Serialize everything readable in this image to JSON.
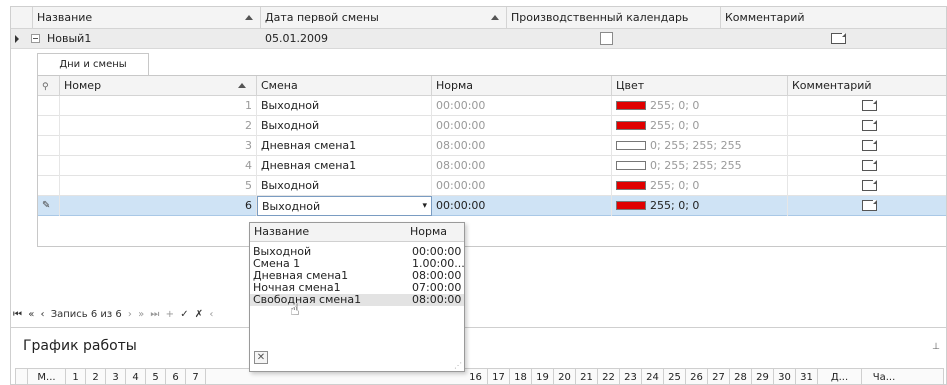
{
  "master": {
    "headers": [
      "Название",
      "Дата первой смены",
      "Производственный календарь",
      "Комментарий"
    ],
    "row": {
      "name": "Новый1",
      "date": "05.01.2009"
    }
  },
  "detail": {
    "tab": "Дни и смены",
    "headers": [
      "Номер",
      "Смена",
      "Норма",
      "Цвет",
      "Комментарий"
    ],
    "rows": [
      {
        "num": "1",
        "shift": "Выходной",
        "norm": "00:00:00",
        "color": "255; 0; 0",
        "swatch": "#e00000"
      },
      {
        "num": "2",
        "shift": "Выходной",
        "norm": "00:00:00",
        "color": "255; 0; 0",
        "swatch": "#e00000"
      },
      {
        "num": "3",
        "shift": "Дневная смена1",
        "norm": "08:00:00",
        "color": "0; 255; 255; 255",
        "swatch": "#ffffff"
      },
      {
        "num": "4",
        "shift": "Дневная смена1",
        "norm": "08:00:00",
        "color": "0; 255; 255; 255",
        "swatch": "#ffffff"
      },
      {
        "num": "5",
        "shift": "Выходной",
        "norm": "00:00:00",
        "color": "255; 0; 0",
        "swatch": "#e00000"
      },
      {
        "num": "6",
        "shift": "Выходной",
        "norm": "00:00:00",
        "color": "255; 0; 0",
        "swatch": "#e00000"
      }
    ]
  },
  "dropdown": {
    "headers": [
      "Название",
      "Норма"
    ],
    "items": [
      {
        "name": "Выходной",
        "norm": "00:00:00"
      },
      {
        "name": "Смена 1",
        "norm": "1.00:00..."
      },
      {
        "name": "Дневная смена1",
        "norm": "08:00:00"
      },
      {
        "name": "Ночная смена1",
        "norm": "07:00:00"
      },
      {
        "name": "Свободная смена1",
        "norm": "08:00:00"
      }
    ],
    "close": "✕"
  },
  "navigator": {
    "record_text": "Запись 6 из 6"
  },
  "schedule": {
    "title": "График работы",
    "days_visible_left": [
      "М...",
      "1",
      "2",
      "3",
      "4",
      "5",
      "6",
      "7"
    ],
    "days_visible_right": [
      "16",
      "17",
      "18",
      "19",
      "20",
      "21",
      "22",
      "23",
      "24",
      "25",
      "26",
      "27",
      "28",
      "29",
      "30",
      "31",
      "Д...",
      "Ча..."
    ]
  },
  "colors": {
    "selection": "#cfe3f5",
    "red": "#e00000"
  }
}
